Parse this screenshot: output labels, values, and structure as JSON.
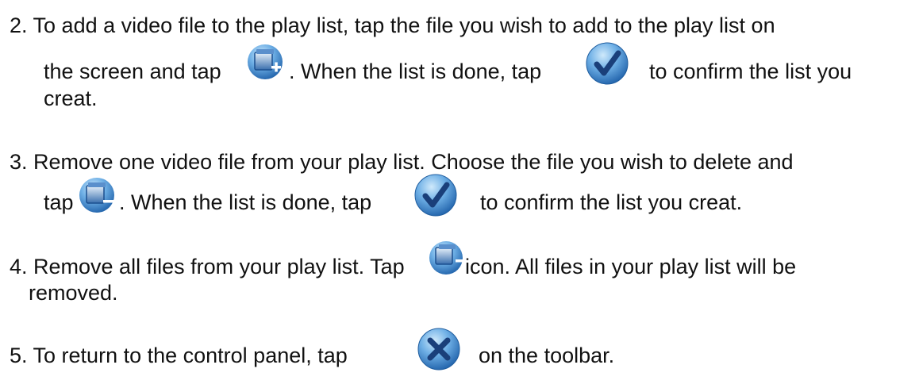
{
  "items": [
    {
      "line1": "2. To add a video file to the play list, tap the file you wish to add to the play list on",
      "line2a": "the screen and tap",
      "line2b": ". When the list is done, tap",
      "line2c": "to confirm the list you",
      "line3": "creat.",
      "icons": [
        "add-to-playlist-icon",
        "confirm-check-icon"
      ]
    },
    {
      "line1": "3. Remove one video file from your play list. Choose the file you wish to delete and",
      "line2a": "tap",
      "line2b": ". When the list is done, tap",
      "line2c": "to confirm the list you creat.",
      "icons": [
        "remove-from-playlist-icon",
        "confirm-check-icon"
      ]
    },
    {
      "line1a": "4. Remove all files from your play list. Tap",
      "line1b": "icon. All files in your play list will be",
      "line2": "removed.",
      "icons": [
        "remove-all-icon"
      ]
    },
    {
      "line1a": "5.  To return to the control panel, tap",
      "line1b": "on the toolbar.",
      "icons": [
        "close-x-icon"
      ]
    }
  ],
  "colors": {
    "icon_blue": "#2f78c4",
    "icon_light": "#9fd0f5",
    "text": "#111111"
  }
}
